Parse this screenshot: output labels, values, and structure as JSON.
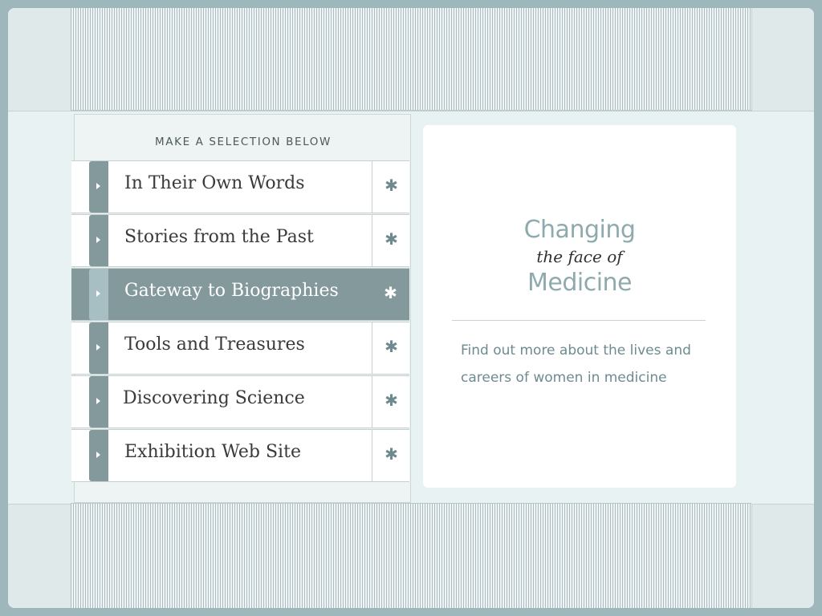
{
  "menu": {
    "heading": "MAKE A SELECTION BELOW",
    "items": [
      {
        "label": "In Their Own Words",
        "star": "✱",
        "active": false
      },
      {
        "label": "Stories from the Past",
        "star": "✱",
        "active": false
      },
      {
        "label": "Gateway to Biographies",
        "star": "✱",
        "active": true
      },
      {
        "label": "Tools and Treasures",
        "star": "✱",
        "active": false
      },
      {
        "label": "Discovering Science",
        "star": "✱",
        "active": false
      },
      {
        "label": "Exhibition Web Site",
        "star": "✱",
        "active": false
      }
    ]
  },
  "info": {
    "logo_line1": "Changing",
    "logo_line2": "the face of",
    "logo_line3": "Medicine",
    "description": "Find out more about the lives and careers of women in medicine"
  },
  "icons": {
    "tab_arrow": "arrow-right-icon",
    "item_star": "asterisk-icon"
  },
  "colors": {
    "accent": "#84999c",
    "brand_text": "#8faaae",
    "background": "#9db7bb"
  }
}
